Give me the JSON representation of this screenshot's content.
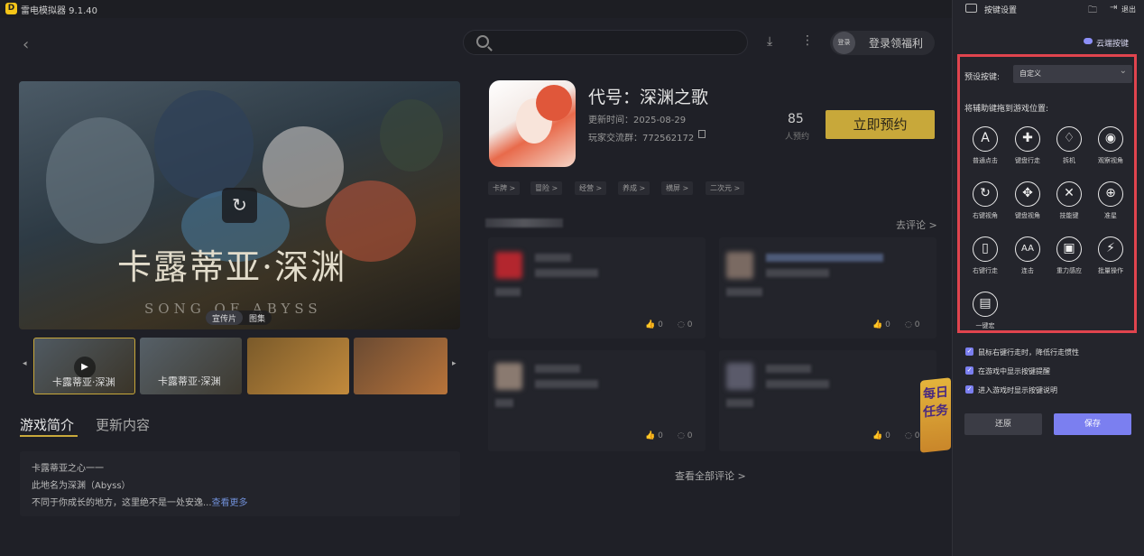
{
  "window": {
    "title": "雷电模拟器 9.1.40",
    "logo_text": "D"
  },
  "header": {
    "login_avatar_text": "登录",
    "login_text": "登录领福利",
    "search_placeholder": ""
  },
  "hero": {
    "title_text": "卡露蒂亚·深渊",
    "subtitle_text": "SONG OF ABYSS",
    "media_tabs": [
      "宣传片",
      "图集"
    ]
  },
  "thumbnails": [
    {
      "label": "卡露蒂亚·深渊",
      "colors": [
        "#505a62",
        "#3a3428"
      ]
    },
    {
      "label": "卡露蒂亚·深渊",
      "colors": [
        "#566068",
        "#3e3a30"
      ]
    },
    {
      "label": "",
      "colors": [
        "#7a5a2a",
        "#c28a3c"
      ]
    },
    {
      "label": "",
      "colors": [
        "#6a4a32",
        "#b8743a"
      ]
    }
  ],
  "tabs": {
    "intro": "游戏简介",
    "update": "更新内容"
  },
  "intro": {
    "line1": "卡露蒂亚之心一一",
    "line2": "此地名为深渊（Abyss）",
    "line3": "不同于你成长的地方，这里绝不是一处安逸...",
    "read_more": "查看更多"
  },
  "game": {
    "title": "代号：深渊之歌",
    "update_time": "更新时间：2025-08-29",
    "group": "玩家交流群：772562172",
    "reserve_count": "85",
    "reserve_count_label": "人预约",
    "reserve_button": "立即预约",
    "tags": [
      "卡牌 >",
      "冒险 >",
      "经营 >",
      "养成 >",
      "横屏 >",
      "二次元 >"
    ]
  },
  "comments": {
    "go_comment": "去评论 >",
    "all_comments": "查看全部评论 >",
    "cards": [
      {
        "likes": "0",
        "replies": "0",
        "avatar_color": "#b3262e"
      },
      {
        "likes": "0",
        "replies": "0",
        "avatar_color": "#7a6a62"
      },
      {
        "likes": "0",
        "replies": "0",
        "avatar_color": "#8a7a70"
      },
      {
        "likes": "0",
        "replies": "0",
        "avatar_color": "#5a5a6a"
      }
    ],
    "daily_task": "每日任务"
  },
  "panel": {
    "title": "按键设置",
    "exit": "退出",
    "cloud": "云端按键",
    "preset_label": "预设按键:",
    "preset_value": "自定义",
    "drag_hint": "将辅助键拖到游戏位置:",
    "keys": [
      {
        "icon": "A",
        "label": "普通点击"
      },
      {
        "icon": "✚",
        "label": "键盘行走"
      },
      {
        "icon": "♢",
        "label": "拆机"
      },
      {
        "icon": "◉",
        "label": "观察视角"
      },
      {
        "icon": "↻",
        "label": "右键视角"
      },
      {
        "icon": "✥",
        "label": "键盘视角"
      },
      {
        "icon": "✕",
        "label": "技能键"
      },
      {
        "icon": "⊕",
        "label": "准星"
      },
      {
        "icon": "▯",
        "label": "右键行走"
      },
      {
        "icon": "AA",
        "label": "连击"
      },
      {
        "icon": "▣",
        "label": "重力感应"
      },
      {
        "icon": "⚡",
        "label": "批量操作"
      },
      {
        "icon": "▤",
        "label": "一键宏"
      }
    ],
    "options": [
      "鼠标右键行走时，降低行走惯性",
      "在游戏中显示按键提醒",
      "进入游戏时显示按键说明"
    ],
    "reset": "还原",
    "save": "保存"
  },
  "colors": {
    "accent": "#c8a83a",
    "primary": "#7b7ff0",
    "highlight": "#e0444e"
  }
}
